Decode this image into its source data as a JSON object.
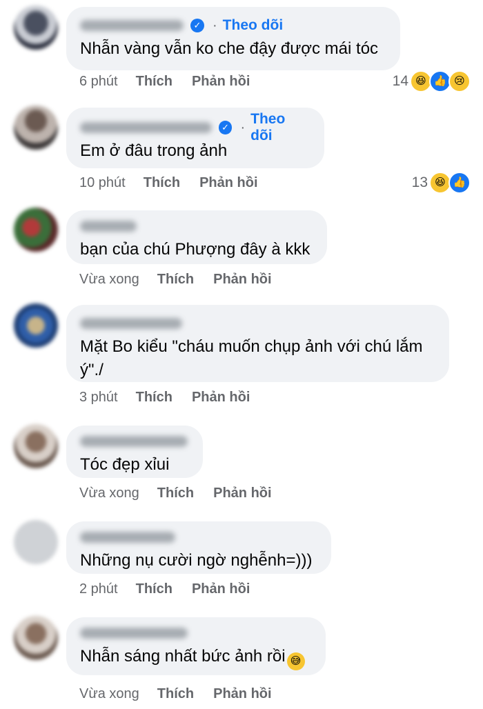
{
  "comments": [
    {
      "text": "Nhẫn vàng vẫn ko che đậy được mái tóc",
      "verified": true,
      "follow_label": "Theo dõi",
      "time": "6 phút",
      "like_label": "Thích",
      "reply_label": "Phản hồi",
      "reaction_count": "14",
      "reactions": [
        "haha-icon",
        "like-icon",
        "sad-icon"
      ]
    },
    {
      "text": "Em ở đâu trong ảnh",
      "verified": true,
      "follow_label": "Theo dõi",
      "time": "10 phút",
      "like_label": "Thích",
      "reply_label": "Phản hồi",
      "reaction_count": "13",
      "reactions": [
        "haha-icon",
        "like-icon"
      ]
    },
    {
      "text": "bạn của chú Phượng đây à kkk",
      "time": "Vừa xong",
      "like_label": "Thích",
      "reply_label": "Phản hồi"
    },
    {
      "text_line1": "Mặt Bo kiểu \"cháu muốn chụp ảnh với chú lắm",
      "text_line2": "ý\"./",
      "time": "3 phút",
      "like_label": "Thích",
      "reply_label": "Phản hồi"
    },
    {
      "text": "Tóc đẹp xỉui",
      "time": "Vừa xong",
      "like_label": "Thích",
      "reply_label": "Phản hồi"
    },
    {
      "text": "Những nụ cười ngờ nghễnh=)))",
      "time": "2 phút",
      "like_label": "Thích",
      "reply_label": "Phản hồi"
    },
    {
      "text": "Nhẫn sáng nhất bức ảnh rồi",
      "time": "Vừa xong",
      "like_label": "Thích",
      "reply_label": "Phản hồi"
    }
  ],
  "colors": {
    "accent": "#1877f2",
    "bubble": "#f0f2f5",
    "meta": "#65676b"
  }
}
